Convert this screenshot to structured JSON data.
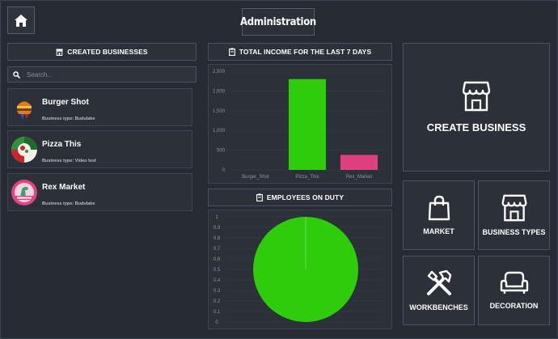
{
  "header": {
    "title": "Administration"
  },
  "created_businesses": {
    "heading": "CREATED BUSINESSES",
    "search_placeholder": "Search...",
    "items": [
      {
        "name": "Burger Shot",
        "type_text": "Business type: Budulake"
      },
      {
        "name": "Pizza This",
        "type_text": "Business type: Video test"
      },
      {
        "name": "Rex Market",
        "type_text": "Business type: Budulake"
      }
    ]
  },
  "income": {
    "heading": "TOTAL INCOME FOR THE LAST 7 DAYS",
    "chart_data": {
      "type": "bar",
      "categories": [
        "Burger_Shot",
        "Pizza_This",
        "Rex_Market"
      ],
      "values": [
        0,
        2300,
        380
      ],
      "colors": [
        "#2ecc0b",
        "#2ecc0b",
        "#e0407e"
      ],
      "ylim": [
        0,
        2500
      ],
      "yticks": [
        0,
        500,
        1000,
        1500,
        2000,
        2500
      ],
      "ytick_labels": [
        "0",
        "500",
        "1,000",
        "1,500",
        "2,000",
        "2,500"
      ]
    }
  },
  "employees": {
    "heading": "EMPLOYEES ON DUTY",
    "chart_data": {
      "type": "pie",
      "slices": [
        {
          "value": 1,
          "color": "#2ecc0b"
        }
      ],
      "yticks": [
        0,
        0.1,
        0.2,
        0.3,
        0.4,
        0.5,
        0.6,
        0.7,
        0.8,
        0.9,
        1
      ],
      "ytick_labels": [
        "0",
        "0.1",
        "0.2",
        "0.3",
        "0.4",
        "0.5",
        "0.6",
        "0.7",
        "0.8",
        "0.9",
        "1"
      ]
    }
  },
  "actions": {
    "create_business": "CREATE BUSINESS",
    "market": "MARKET",
    "business_types": "BUSINESS TYPES",
    "workbenches": "WORKBENCHES",
    "decoration": "DECORATION"
  },
  "colors": {
    "accent_green": "#2ecc0b",
    "accent_pink": "#e0407e",
    "panel": "#2b3039"
  }
}
